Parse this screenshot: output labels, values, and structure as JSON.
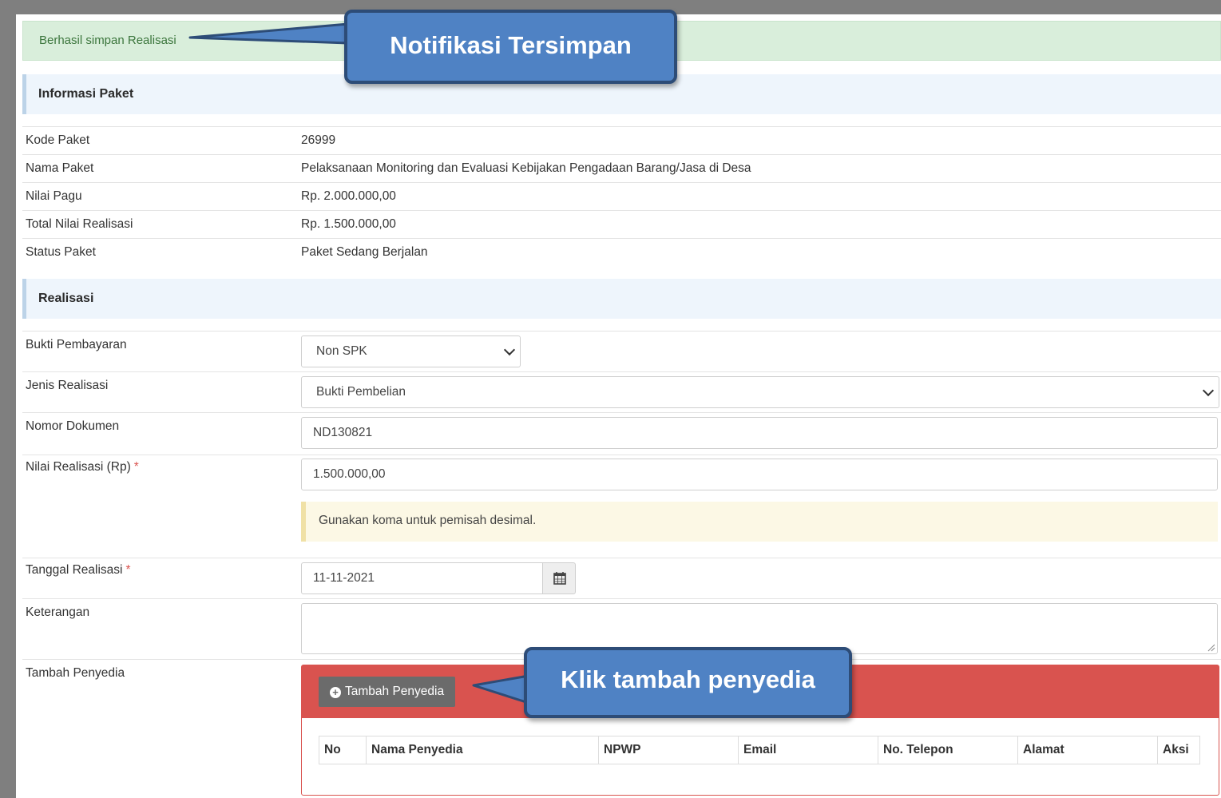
{
  "alert": {
    "text": "Berhasil simpan Realisasi"
  },
  "callouts": {
    "saved": "Notifikasi Tersimpan",
    "add_provider": "Klik tambah penyedia"
  },
  "info": {
    "title": "Informasi Paket",
    "rows": [
      {
        "label": "Kode Paket",
        "value": "26999"
      },
      {
        "label": "Nama Paket",
        "value": "Pelaksanaan Monitoring dan Evaluasi Kebijakan Pengadaan Barang/Jasa di Desa"
      },
      {
        "label": "Nilai Pagu",
        "value": "Rp. 2.000.000,00"
      },
      {
        "label": "Total Nilai Realisasi",
        "value": "Rp. 1.500.000,00"
      },
      {
        "label": "Status Paket",
        "value": "Paket Sedang Berjalan"
      }
    ]
  },
  "realisasi": {
    "title": "Realisasi",
    "bukti_label": "Bukti Pembayaran",
    "bukti_value": "Non SPK",
    "jenis_label": "Jenis Realisasi",
    "jenis_value": "Bukti Pembelian",
    "nomor_label": "Nomor Dokumen",
    "nomor_value": "ND130821",
    "nilai_label": "Nilai Realisasi (Rp)",
    "nilai_value": "1.500.000,00",
    "nilai_hint": "Gunakan koma untuk pemisah desimal.",
    "tanggal_label": "Tanggal Realisasi",
    "tanggal_value": "11-11-2021",
    "ket_label": "Keterangan",
    "ket_value": "",
    "penyedia_label": "Tambah Penyedia",
    "required_mark": "*"
  },
  "penyedia": {
    "button": "Tambah Penyedia",
    "columns": [
      "No",
      "Nama Penyedia",
      "NPWP",
      "Email",
      "No. Telepon",
      "Alamat",
      "Aksi"
    ]
  },
  "colors": {
    "alert_bg": "#d9eedb",
    "panel_red": "#d9534f",
    "callout_blue": "#4f82c4"
  },
  "icons": {
    "calendar": "calendar-icon",
    "plus": "plus-circle-icon",
    "chevron": "chevron-down-icon"
  }
}
